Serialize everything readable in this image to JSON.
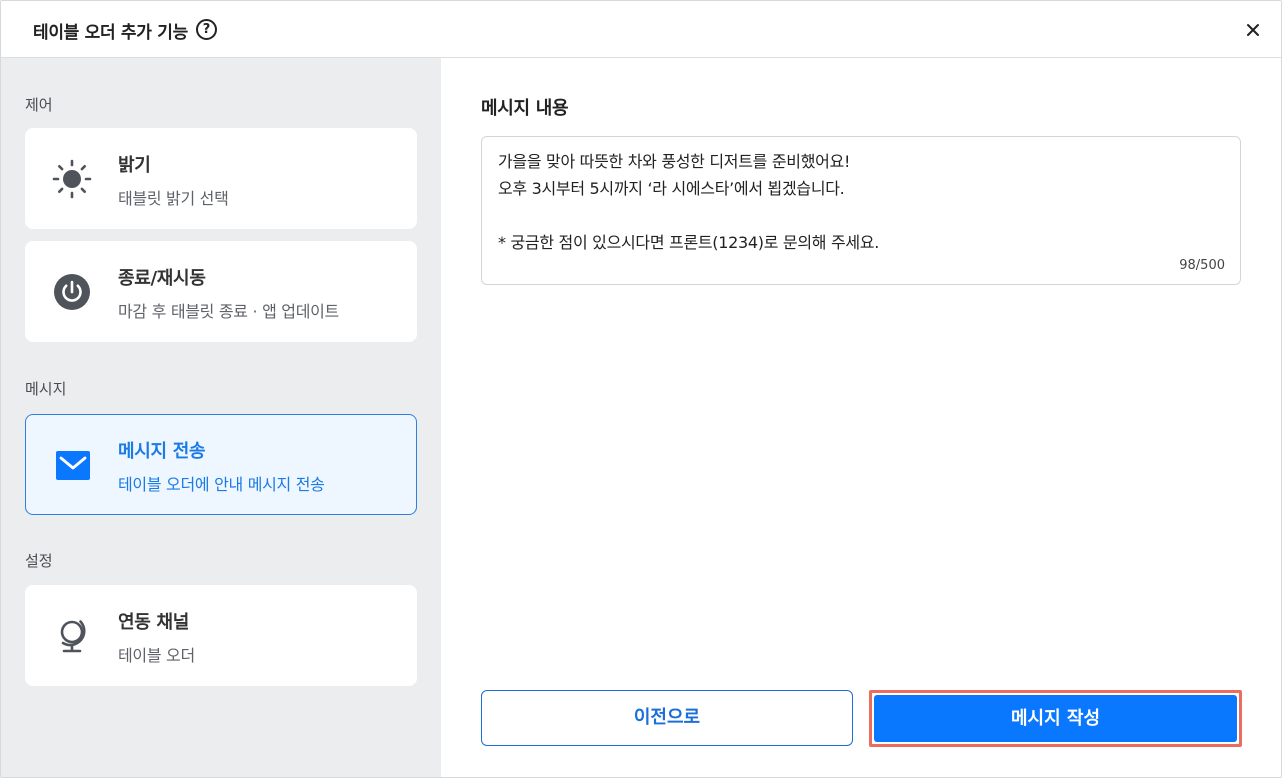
{
  "header": {
    "title": "테이블 오더 추가 기능",
    "help_symbol": "?"
  },
  "sidebar": {
    "sections": [
      {
        "label": "제어"
      },
      {
        "label": "메시지"
      },
      {
        "label": "설정"
      }
    ],
    "items": [
      {
        "title": "밝기",
        "subtitle": "태블릿 밝기 선택",
        "icon": "sun-icon"
      },
      {
        "title": "종료/재시동",
        "subtitle": "마감 후 태블릿 종료 · 앱 업데이트",
        "icon": "power-icon"
      },
      {
        "title": "메시지 전송",
        "subtitle": "테이블 오더에 안내 메시지 전송",
        "icon": "envelope-icon",
        "active": true
      },
      {
        "title": "연동 채널",
        "subtitle": "테이블 오더",
        "icon": "globe-icon"
      }
    ]
  },
  "main": {
    "title": "메시지 내용",
    "message_lines": [
      "가을을 맞아 따뜻한 차와 풍성한 디저트를 준비했어요!",
      "오후 3시부터 5시까지 ‘라 시에스타’에서 뵙겠습니다.",
      "",
      "* 궁금한 점이 있으시다면 프론트(1234)로 문의해 주세요."
    ],
    "char_count": "98/500"
  },
  "buttons": {
    "prev_label": "이전으로",
    "write_label": "메시지 작성"
  },
  "colors": {
    "accent": "#0a77ff",
    "active_border": "#2f7fe0",
    "highlight_outline": "#ec6c5e",
    "sidebar_bg": "#ebedef"
  }
}
